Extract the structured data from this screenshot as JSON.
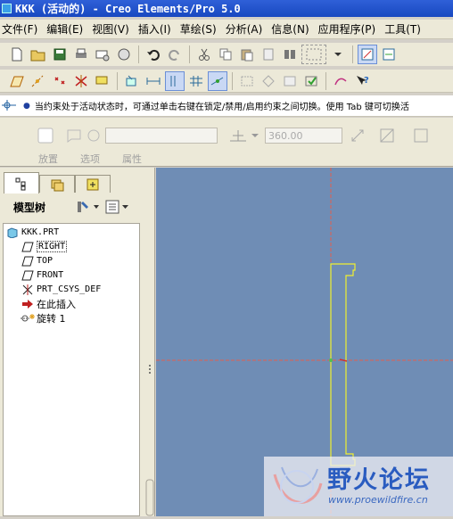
{
  "window": {
    "title": "KKK (活动的) - Creo Elements/Pro 5.0"
  },
  "menu": [
    "文件(F)",
    "编辑(E)",
    "视图(V)",
    "插入(I)",
    "草绘(S)",
    "分析(A)",
    "信息(N)",
    "应用程序(P)",
    "工具(T)"
  ],
  "message": "当约束处于活动状态时，可通过单击右键在锁定/禁用/启用约束之间切换。使用 Tab 键可切换活",
  "dashboard": {
    "angle_value": "360.00",
    "tabs": [
      "放置",
      "选项",
      "属性"
    ]
  },
  "model_tree": {
    "title": "模型树",
    "items": [
      "KKK.PRT",
      "RIGHT",
      "TOP",
      "FRONT",
      "PRT_CSYS_DEF",
      "在此插入",
      "旋转 1"
    ]
  },
  "watermark": {
    "text": "野火论坛",
    "url": "www.proewildfire.cn"
  },
  "colors": {
    "canvas": "#6f8db5",
    "sketch_line": "#f0f030",
    "title_bar": "#1f52c8"
  }
}
